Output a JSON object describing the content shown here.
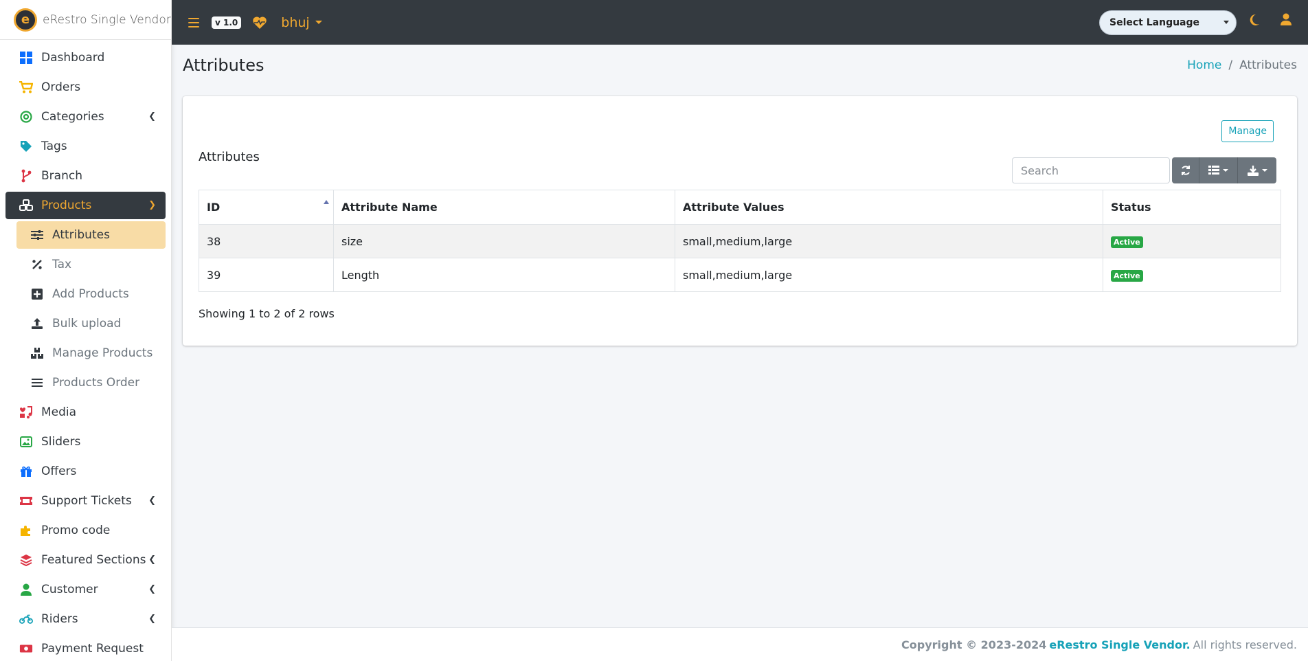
{
  "brand": {
    "name": "eRestro Single Vendor",
    "logo_letter": "e"
  },
  "topbar": {
    "version": "v 1.0",
    "branch": "bhuj",
    "language_label": "Select Language",
    "accent_color": "#f0a830"
  },
  "sidebar": {
    "items": [
      {
        "label": "Dashboard",
        "icon": "dashboard-icon"
      },
      {
        "label": "Orders",
        "icon": "cart-icon"
      },
      {
        "label": "Categories",
        "icon": "bullseye-icon"
      },
      {
        "label": "Tags",
        "icon": "tag-icon"
      },
      {
        "label": "Branch",
        "icon": "branch-icon"
      },
      {
        "label": "Products",
        "icon": "cubes-icon"
      },
      {
        "label": "Media",
        "icon": "media-icon"
      },
      {
        "label": "Sliders",
        "icon": "image-icon"
      },
      {
        "label": "Offers",
        "icon": "gift-icon"
      },
      {
        "label": "Support Tickets",
        "icon": "ticket-icon"
      },
      {
        "label": "Promo code",
        "icon": "puzzle-icon"
      },
      {
        "label": "Featured Sections",
        "icon": "layers-icon"
      },
      {
        "label": "Customer",
        "icon": "user-icon"
      },
      {
        "label": "Riders",
        "icon": "motorcycle-icon"
      },
      {
        "label": "Payment Request",
        "icon": "money-icon"
      }
    ],
    "products_sub": [
      {
        "label": "Attributes",
        "icon": "sliders-icon"
      },
      {
        "label": "Tax",
        "icon": "percent-icon"
      },
      {
        "label": "Add Products",
        "icon": "plus-square-icon"
      },
      {
        "label": "Bulk upload",
        "icon": "upload-icon"
      },
      {
        "label": "Manage Products",
        "icon": "boxes-icon"
      },
      {
        "label": "Products Order",
        "icon": "list-icon"
      }
    ]
  },
  "page": {
    "title": "Attributes",
    "breadcrumb_home": "Home",
    "breadcrumb_sep": "/",
    "breadcrumb_current": "Attributes"
  },
  "card": {
    "manage_label": "Manage",
    "title": "Attributes",
    "search_placeholder": "Search",
    "columns": [
      "ID",
      "Attribute Name",
      "Attribute Values",
      "Status"
    ],
    "rows": [
      {
        "id": "38",
        "name": "size",
        "values": "small,medium,large",
        "status": "Active"
      },
      {
        "id": "39",
        "name": "Length",
        "values": "small,medium,large",
        "status": "Active"
      }
    ],
    "rows_info": "Showing 1 to 2 of 2 rows"
  },
  "footer": {
    "copyright": "Copyright © 2023-2024",
    "brand": "eRestro Single Vendor.",
    "rights": "All rights reserved."
  }
}
